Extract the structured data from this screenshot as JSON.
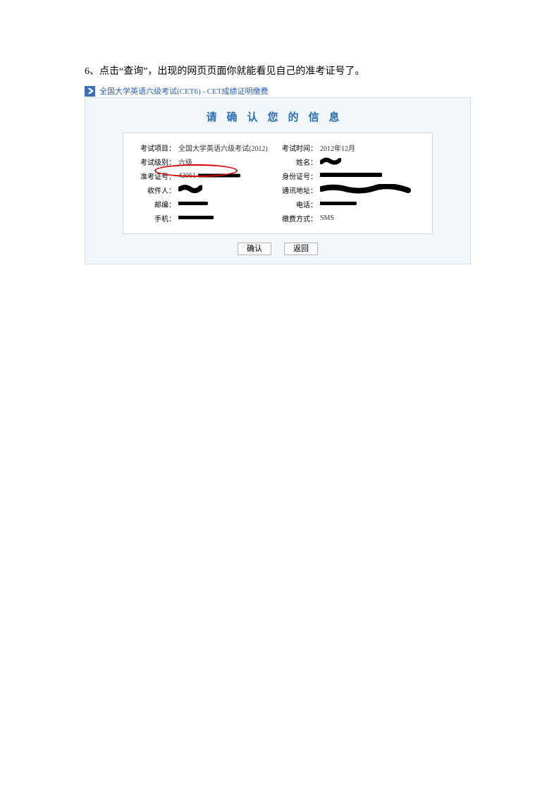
{
  "instruction": "6、点击“查询”，出现的网页页面你就能看见自己的准考证号了。",
  "panel": {
    "title": "全国大学英语六级考试(CET6) - CET成绩证明缴费",
    "confirm_heading": "请确认您的信息"
  },
  "info": {
    "exam_project_label": "考试项目：",
    "exam_project_value": "全国大学英语六级考试(2012)",
    "exam_time_label": "考试时间：",
    "exam_time_value": "2012年12月",
    "exam_level_label": "考试级别：",
    "exam_level_value": "六级",
    "name_label": "姓名：",
    "admission_num_label": "准考证号：",
    "admission_num_value": "42061",
    "idcard_label": "身份证号：",
    "recipient_label": "收件人：",
    "address_label": "通讯地址：",
    "postcode_label": "邮编：",
    "phone_label": "电话：",
    "mobile_label": "手机：",
    "payment_method_label": "缴费方式：",
    "payment_method_value": "SMS"
  },
  "buttons": {
    "confirm": "确认",
    "back": "返回"
  }
}
